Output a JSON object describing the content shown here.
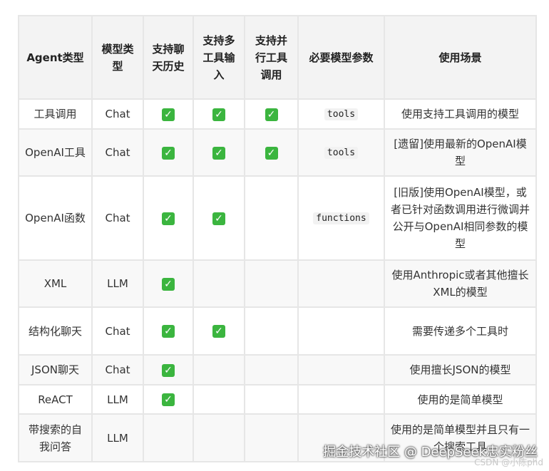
{
  "table": {
    "headers": [
      "Agent类型",
      "模型类型",
      "支持聊天历史",
      "支持多工具输入",
      "支持并行工具调用",
      "必要模型参数",
      "使用场景"
    ],
    "rows": [
      {
        "agent": "工具调用",
        "model": "Chat",
        "history": true,
        "multi": true,
        "parallel": true,
        "param": "tools",
        "usage": "使用支持工具调用的模型"
      },
      {
        "agent": "OpenAI工具",
        "model": "Chat",
        "history": true,
        "multi": true,
        "parallel": true,
        "param": "tools",
        "usage": "[遗留]使用最新的OpenAI模型"
      },
      {
        "agent": "OpenAI函数",
        "model": "Chat",
        "history": true,
        "multi": true,
        "parallel": false,
        "param": "functions",
        "usage": "[旧版]使用OpenAI模型，或者已针对函数调用进行微调并公开与OpenAI相同参数的模型"
      },
      {
        "agent": "XML",
        "model": "LLM",
        "history": true,
        "multi": false,
        "parallel": false,
        "param": "",
        "usage": "使用Anthropic或者其他擅长XML的模型"
      },
      {
        "agent": "结构化聊天",
        "model": "Chat",
        "history": true,
        "multi": true,
        "parallel": false,
        "param": "",
        "usage": "需要传递多个工具时"
      },
      {
        "agent": "JSON聊天",
        "model": "Chat",
        "history": true,
        "multi": false,
        "parallel": false,
        "param": "",
        "usage": "使用擅长JSON的模型"
      },
      {
        "agent": "ReACT",
        "model": "LLM",
        "history": true,
        "multi": false,
        "parallel": false,
        "param": "",
        "usage": "使用的是简单模型"
      },
      {
        "agent": "带搜索的自我问答",
        "model": "LLM",
        "history": false,
        "multi": false,
        "parallel": false,
        "param": "",
        "usage": "使用的是简单模型并且只有一个搜索工具"
      }
    ],
    "check_glyph": "✓",
    "check_color": "#3bb53f"
  },
  "watermark": "掘金技术社区 @ DeepSeek忠实粉丝",
  "csdn_mark": "CSDN @小陈phd"
}
